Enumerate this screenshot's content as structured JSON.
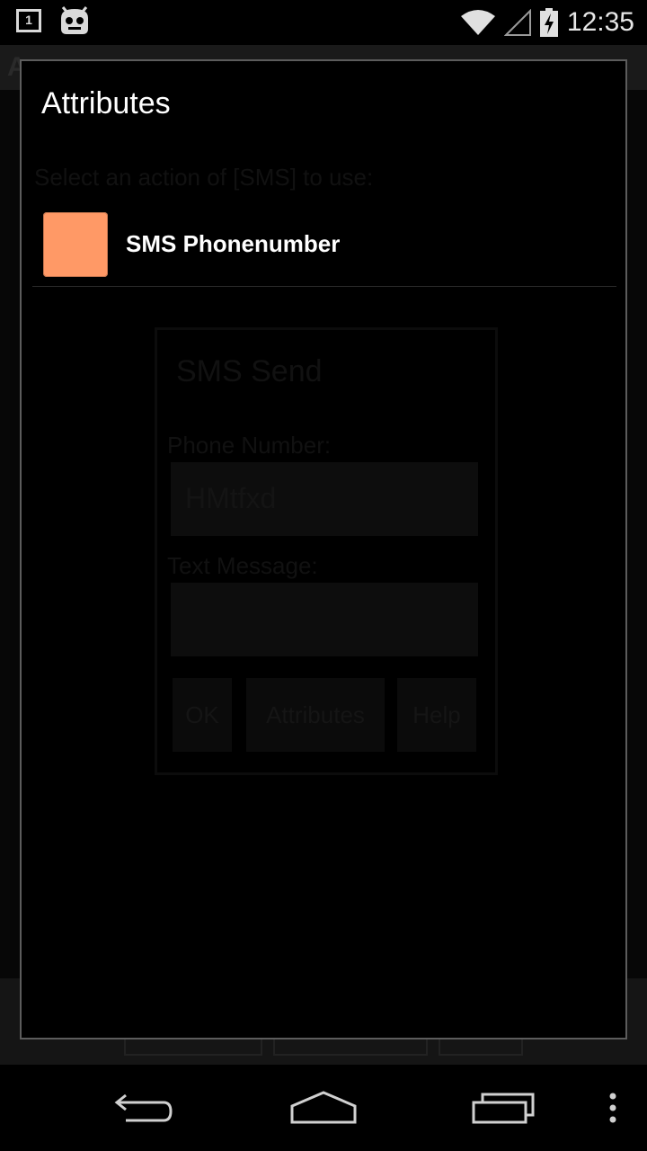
{
  "status_bar": {
    "notification_count": "1",
    "time": "12:35",
    "icons": [
      "notification-box-icon",
      "android-bot-icon",
      "wifi-icon",
      "signal-icon",
      "battery-charging-icon"
    ]
  },
  "background": {
    "title_fragment": "A",
    "section_label": "Select an action of [SMS] to use:",
    "dialog_title": "SMS Send",
    "phone_label": "Phone Number:",
    "phone_value": "HMtfxd",
    "text_label": "Text Message:",
    "text_value": "",
    "buttons": [
      "OK",
      "Attributes",
      "Help"
    ]
  },
  "dialog": {
    "title": "Attributes",
    "items": [
      {
        "label": "SMS Phonenumber",
        "swatch_color": "#ff9966"
      }
    ]
  },
  "nav_bar": {
    "icons": [
      "back-icon",
      "home-icon",
      "recents-icon",
      "overflow-menu-icon"
    ]
  }
}
